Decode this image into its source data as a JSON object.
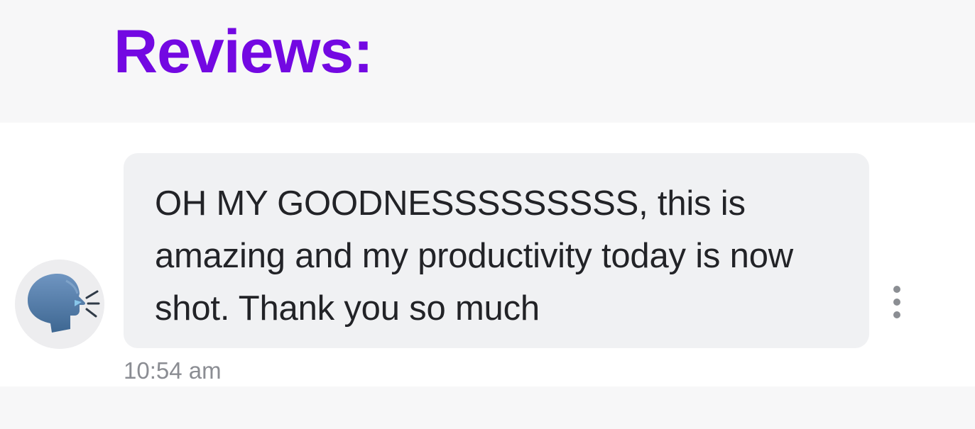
{
  "header": {
    "title": "Reviews:",
    "title_color": "#7308e2"
  },
  "message": {
    "avatar_icon": "speaking-head-icon",
    "text": "OH MY GOODNESSSSSSSSS, this is amazing and my productivity today is now shot. Thank you so much",
    "timestamp": "10:54 am",
    "more_icon": "more-vertical-icon"
  }
}
